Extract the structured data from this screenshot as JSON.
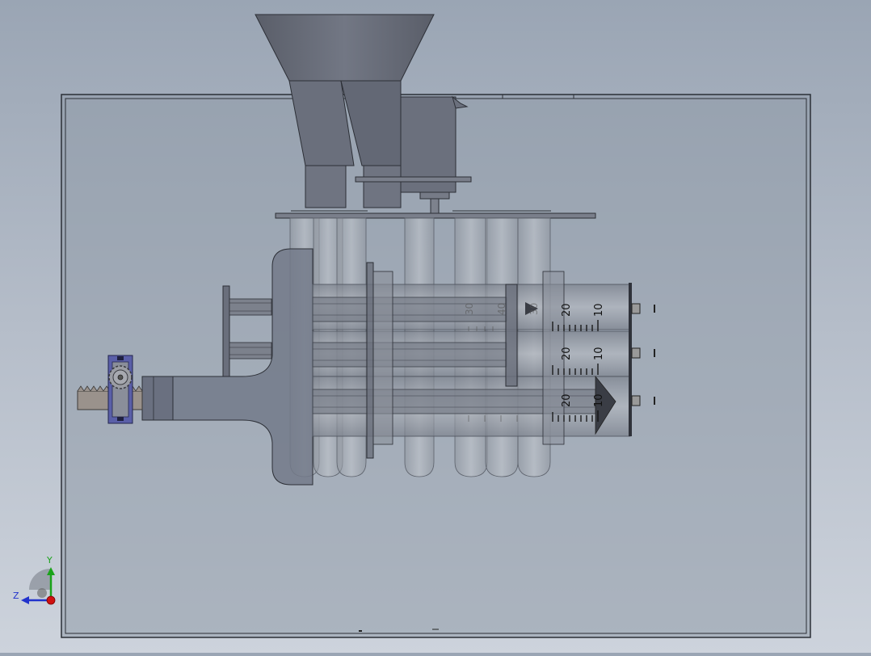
{
  "scale_labels": {
    "row1": [
      "20",
      "10"
    ],
    "row2": [
      "20",
      "10"
    ],
    "row3": [
      "20",
      "10"
    ],
    "faint": [
      "30",
      "40",
      "30"
    ]
  },
  "triad": {
    "y_label": "Y",
    "z_label": "Z",
    "y_color": "#1aa31a",
    "z_color": "#2233cc",
    "x_color": "#d01010"
  },
  "colors": {
    "background_top": "#9aa5b4",
    "background_bottom": "#cdd3dc",
    "sheet_fill": "#8f9aa8",
    "part_fill": "#6d7280",
    "tube_fill": "#a7adb6",
    "gear_bracket": "#5a5fa8",
    "rack_fill": "#9a928c"
  },
  "icons": {
    "triad": "coordinate-triad-icon",
    "gear": "gear-icon"
  }
}
